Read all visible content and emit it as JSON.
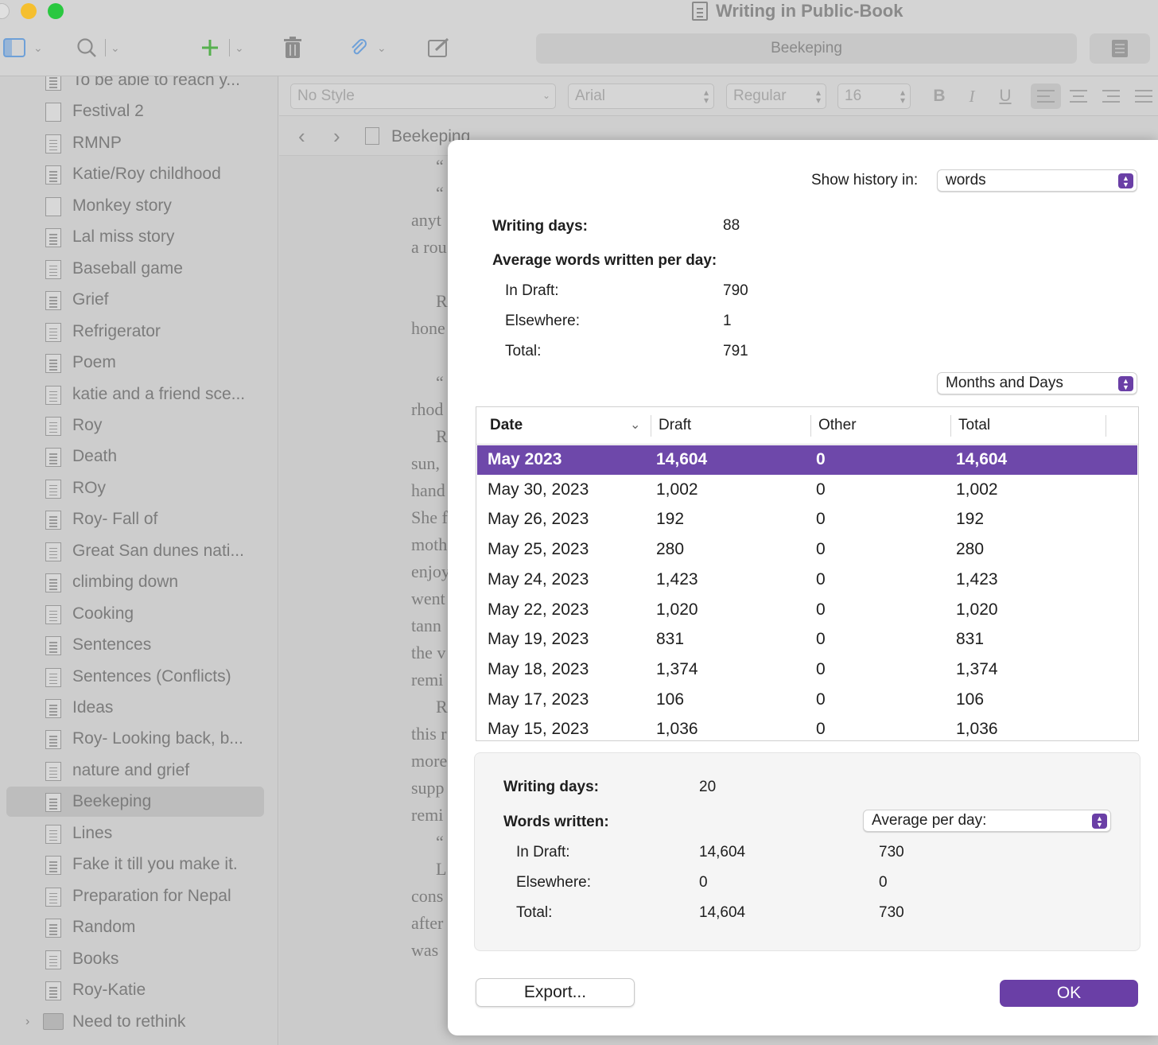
{
  "window": {
    "title": "Writing in Public-Book"
  },
  "toolbar": {
    "document_tab": "Beekeping"
  },
  "format_bar": {
    "style": "No Style",
    "font": "Arial",
    "weight": "Regular",
    "size": "16",
    "bold": "B",
    "italic": "I",
    "underline": "U"
  },
  "navbar": {
    "title": "Beekeping"
  },
  "sidebar": {
    "items": [
      {
        "label": "To be able to reach y...",
        "icon": "file-lines-icon"
      },
      {
        "label": "Festival 2",
        "icon": "file-icon"
      },
      {
        "label": "RMNP",
        "icon": "file-lines-icon"
      },
      {
        "label": "Katie/Roy childhood",
        "icon": "file-lines-icon"
      },
      {
        "label": "Monkey story",
        "icon": "file-icon"
      },
      {
        "label": "Lal miss story",
        "icon": "file-lines-icon"
      },
      {
        "label": "Baseball game",
        "icon": "file-lines-icon"
      },
      {
        "label": "Grief",
        "icon": "file-lines-icon"
      },
      {
        "label": "Refrigerator",
        "icon": "file-lines-icon"
      },
      {
        "label": "Poem",
        "icon": "file-lines-icon"
      },
      {
        "label": "katie and a friend sce...",
        "icon": "file-lines-icon"
      },
      {
        "label": "Roy",
        "icon": "file-lines-icon"
      },
      {
        "label": "Death",
        "icon": "file-lines-icon"
      },
      {
        "label": "ROy",
        "icon": "file-lines-icon"
      },
      {
        "label": "Roy- Fall of",
        "icon": "file-lines-icon"
      },
      {
        "label": "Great San dunes nati...",
        "icon": "file-lines-icon"
      },
      {
        "label": "climbing down",
        "icon": "file-lines-icon"
      },
      {
        "label": "Cooking",
        "icon": "file-lines-icon"
      },
      {
        "label": "Sentences",
        "icon": "file-lines-icon"
      },
      {
        "label": "Sentences (Conflicts)",
        "icon": "file-lines-icon"
      },
      {
        "label": "Ideas",
        "icon": "file-lines-icon"
      },
      {
        "label": "Roy- Looking back, b...",
        "icon": "file-lines-icon"
      },
      {
        "label": "nature and grief",
        "icon": "file-lines-icon"
      },
      {
        "label": "Beekeping",
        "icon": "file-lines-icon",
        "selected": true
      },
      {
        "label": "Lines",
        "icon": "file-lines-icon"
      },
      {
        "label": "Fake it till you make it.",
        "icon": "file-lines-icon"
      },
      {
        "label": "Preparation for Nepal",
        "icon": "file-lines-icon"
      },
      {
        "label": "Random",
        "icon": "file-lines-icon"
      },
      {
        "label": "Books",
        "icon": "file-lines-icon"
      },
      {
        "label": "Roy-Katie",
        "icon": "file-lines-icon"
      },
      {
        "label": "Need to rethink",
        "icon": "folder-icon"
      }
    ]
  },
  "editor": {
    "lines": [
      "“",
      "“",
      "anyt",
      "a rou",
      "R",
      "hone",
      "“",
      "rhod",
      "R",
      "sun,",
      "hand",
      "She f",
      "moth",
      "enjoy",
      "went",
      "tann",
      "the v",
      "remi",
      "R",
      "this r",
      "more",
      "supp",
      "remi",
      "“",
      "L",
      "cons",
      "after",
      "was"
    ]
  },
  "dialog": {
    "show_history_label": "Show history in:",
    "show_history_value": "words",
    "writing_days_label": "Writing days:",
    "writing_days_value": "88",
    "avg_label": "Average words written per day:",
    "avg_rows": [
      {
        "label": "In Draft:",
        "value": "790"
      },
      {
        "label": "Elsewhere:",
        "value": "1"
      },
      {
        "label": "Total:",
        "value": "791"
      }
    ],
    "grouping_value": "Months and Days",
    "table": {
      "headers": [
        "Date",
        "Draft",
        "Other",
        "Total"
      ],
      "rows": [
        [
          "May 2023",
          "14,604",
          "0",
          "14,604"
        ],
        [
          "May 30, 2023",
          "1,002",
          "0",
          "1,002"
        ],
        [
          "May 26, 2023",
          "192",
          "0",
          "192"
        ],
        [
          "May 25, 2023",
          "280",
          "0",
          "280"
        ],
        [
          "May 24, 2023",
          "1,423",
          "0",
          "1,423"
        ],
        [
          "May 22, 2023",
          "1,020",
          "0",
          "1,020"
        ],
        [
          "May 19, 2023",
          "831",
          "0",
          "831"
        ],
        [
          "May 18, 2023",
          "1,374",
          "0",
          "1,374"
        ],
        [
          "May 17, 2023",
          "106",
          "0",
          "106"
        ],
        [
          "May 15, 2023",
          "1,036",
          "0",
          "1,036"
        ]
      ]
    },
    "summary": {
      "writing_days_label": "Writing days:",
      "writing_days_value": "20",
      "words_written_label": "Words written:",
      "mode_value": "Average per day:",
      "rows": [
        {
          "label": "In Draft:",
          "total": "14,604",
          "avg": "730"
        },
        {
          "label": "Elsewhere:",
          "total": "0",
          "avg": "0"
        },
        {
          "label": "Total:",
          "total": "14,604",
          "avg": "730"
        }
      ]
    },
    "export_label": "Export...",
    "ok_label": "OK"
  },
  "colors": {
    "accent": "#6a3fa6",
    "selection": "#6e48aa",
    "plus": "#56b04e",
    "clip": "#6ea0d8"
  }
}
